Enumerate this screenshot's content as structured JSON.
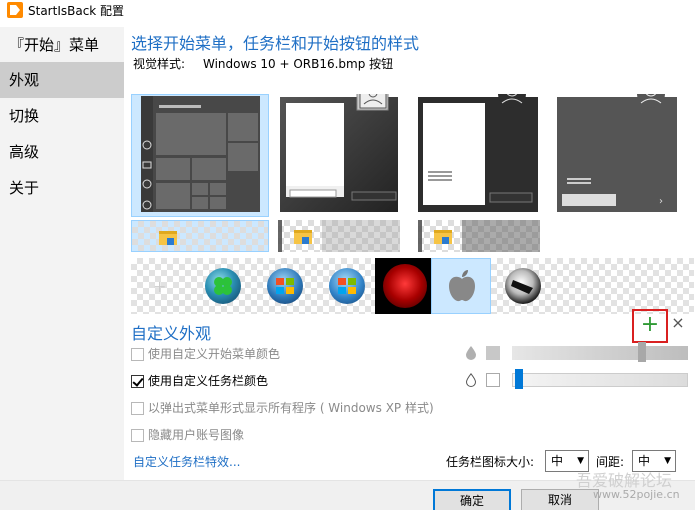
{
  "window": {
    "title": "StartIsBack 配置"
  },
  "sidebar": {
    "items": [
      {
        "label": "『开始』菜单"
      },
      {
        "label": "外观"
      },
      {
        "label": "切换"
      },
      {
        "label": "高级"
      },
      {
        "label": "关于"
      }
    ]
  },
  "main": {
    "heading": "选择开始菜单，任务栏和开始按钮的样式",
    "visual_style_label": "视觉样式:",
    "visual_style_value": "Windows 10 + ORB16.bmp 按钮",
    "start_menu_styles": [
      "style-1",
      "style-2",
      "style-3",
      "style-4"
    ],
    "orbs": [
      "blank",
      "clover",
      "windows-7",
      "windows-xp",
      "red-orb",
      "apple",
      "alienware"
    ],
    "custom_heading": "自定义外观",
    "options": [
      {
        "label": "使用自定义开始菜单颜色",
        "checked": false,
        "enabled": false
      },
      {
        "label": "使用自定义任务栏颜色",
        "checked": true,
        "enabled": true
      },
      {
        "label": "以弹出式菜单形式显示所有程序 ( Windows XP 样式)",
        "checked": false,
        "enabled": false
      },
      {
        "label": "隐藏用户账号图像",
        "checked": false,
        "enabled": false
      }
    ],
    "slider_menu_level": 0.75,
    "slider_taskbar_level": 0.02,
    "add_symbol": "+",
    "remove_symbol": "×",
    "taskbar_effects_link": "自定义任务栏特效...",
    "icon_size_label": "任务栏图标大小:",
    "icon_size_value": "中",
    "spacing_label": "间距:",
    "spacing_value": "中"
  },
  "footer": {
    "ok_label": "确定",
    "cancel_label": "取消",
    "watermark_text": "吾爱破解论坛",
    "watermark_url": "www.52pojie.cn"
  },
  "colors": {
    "accent": "#1f6fc5",
    "selection": "#cce8ff",
    "highlight_box": "#d92020",
    "add_green": "#2f9a35"
  }
}
